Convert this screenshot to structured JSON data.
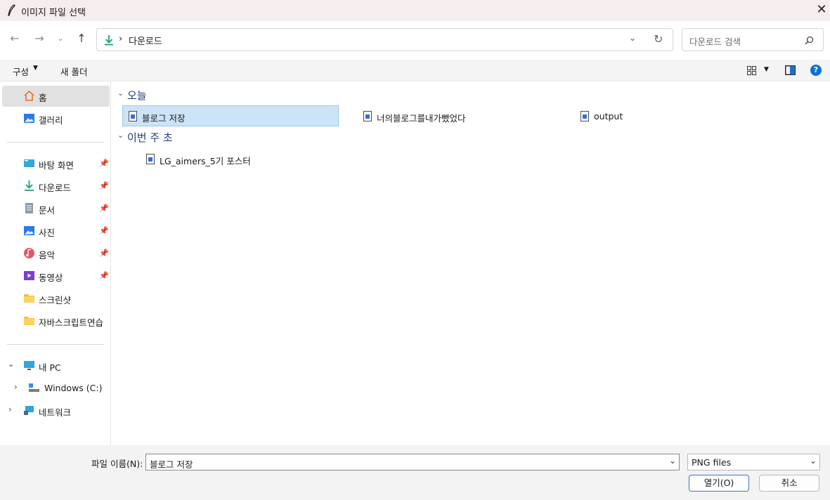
{
  "window": {
    "title": "이미지 파일 선택"
  },
  "address": {
    "location": "다운로드",
    "separator": "›"
  },
  "search": {
    "placeholder": "다운로드 검색"
  },
  "toolbar": {
    "organize_label": "구성",
    "new_folder_label": "새 폴더"
  },
  "sidebar": {
    "home": "홈",
    "gallery": "갤러리",
    "quick_access": [
      {
        "label": "바탕 화면",
        "icon": "desktop-icon"
      },
      {
        "label": "다운로드",
        "icon": "download-icon"
      },
      {
        "label": "문서",
        "icon": "document-icon"
      },
      {
        "label": "사진",
        "icon": "pictures-icon"
      },
      {
        "label": "음악",
        "icon": "music-icon"
      },
      {
        "label": "동영상",
        "icon": "videos-icon"
      },
      {
        "label": "스크린샷",
        "icon": "folder-icon"
      },
      {
        "label": "자바스크립트연습",
        "icon": "folder-icon"
      }
    ],
    "this_pc": "내 PC",
    "drive": "Windows (C:)",
    "network": "네트워크"
  },
  "content": {
    "groups": [
      {
        "label": "오늘",
        "files": [
          "블로그 저장",
          "너의블로그를내가뺐었다",
          "output"
        ]
      },
      {
        "label": "이번 주 초",
        "files": [
          "LG_aimers_5기 포스터"
        ]
      }
    ]
  },
  "footer": {
    "filename_label": "파일 이름(N):",
    "filename_value": "블로그 저장",
    "filetype_value": "PNG files",
    "open_label": "열기(O)",
    "cancel_label": "취소"
  },
  "colors": {
    "accent": "#0067c0",
    "selection": "#cce4f7",
    "group_header": "#1f3d7a"
  }
}
